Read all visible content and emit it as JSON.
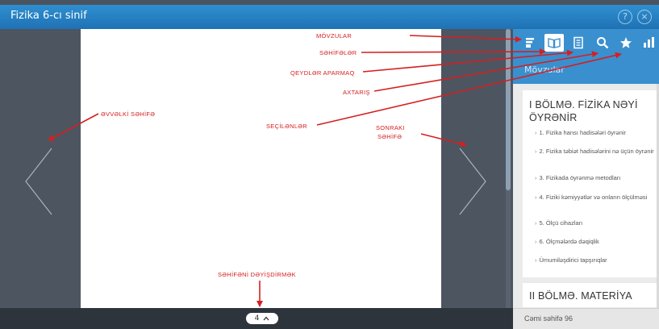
{
  "window": {
    "title": "Fizika 6-cı sinif",
    "help_icon": "?",
    "close_icon": "×"
  },
  "reader": {
    "page_number": "4"
  },
  "toolbar": {
    "icons": [
      "topics-icon",
      "pages-icon",
      "notes-icon",
      "search-icon",
      "bookmark-star-icon",
      "stats-icon"
    ],
    "active": "pages-icon",
    "accent_color": "#3a8fcf"
  },
  "panel": {
    "header": "Mövzular",
    "section1_title": "I BÖLMƏ. FİZİKA NƏYİ ÖYRƏNİR",
    "topics": [
      "1. Fizika hansı hadisələri öyrənir",
      "2. Fizika təbiət hadisələrini nə üçün öyrənir",
      "3. Fizikada öyrənmə metodları",
      "4. Fiziki kəmiyyətlər və onların ölçülməsi",
      "5. Ölçü cihazları",
      "6. Ölçmələrdə dəqiqlik",
      "Ümumiləşdirici tapşırıqlar"
    ],
    "section2_title": "II BÖLMƏ. MATERİYA",
    "footer": "Cəmi səhifə 96"
  },
  "annotations": {
    "movzular": "MÖVZULAR",
    "sehifeler": "SƏHİFƏLƏR",
    "qeydler": "QEYDLƏR APARMAQ",
    "axtaris": "AXTARIŞ",
    "secilenler": "SEÇİLƏNLƏR",
    "evvelki": "ƏVVƏLKİ SƏHİFƏ",
    "sonraki_1": "SONRAKI",
    "sonraki_2": "SƏHİFƏ",
    "deyisdirmek": "SƏHİFƏNİ DƏYİŞDİRMƏK",
    "color": "#d42020"
  }
}
